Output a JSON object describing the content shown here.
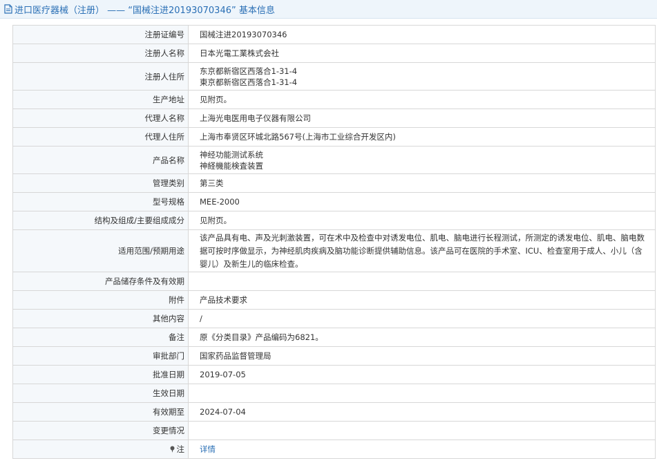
{
  "header": {
    "title": "进口医疗器械（注册） —— “国械注进20193070346” 基本信息",
    "icon": "document-icon"
  },
  "rows": {
    "reg_no": {
      "label": "注册证编号",
      "value": "国械注进20193070346"
    },
    "registrant_name": {
      "label": "注册人名称",
      "value": "日本光電工業株式会社"
    },
    "registrant_address": {
      "label": "注册人住所",
      "value_line1": "东京都新宿区西落合1-31-4",
      "value_line2": "東京都新宿区西落合1-31-4"
    },
    "production_address": {
      "label": "生产地址",
      "value": "见附页。"
    },
    "agent_name": {
      "label": "代理人名称",
      "value": "上海光电医用电子仪器有限公司"
    },
    "agent_address": {
      "label": "代理人住所",
      "value": "上海市奉贤区环城北路567号(上海市工业综合开发区内)"
    },
    "product_name": {
      "label": "产品名称",
      "value_line1": "神经功能测试系统",
      "value_line2": "神経機能検査装置"
    },
    "category": {
      "label": "管理类别",
      "value": "第三类"
    },
    "model": {
      "label": "型号规格",
      "value": "MEE-2000"
    },
    "structure": {
      "label": "结构及组成/主要组成成分",
      "value": "见附页。"
    },
    "scope": {
      "label": "适用范围/预期用途",
      "value": "该产品具有电、声及光刺激装置，可在术中及检查中对诱发电位、肌电、脑电进行长程测试，所测定的诱发电位、肌电、脑电数据可按时序做显示，为神经肌肉疾病及脑功能诊断提供辅助信息。该产品可在医院的手术室、ICU、检查室用于成人、小儿（含婴儿）及新生儿的临床检查。"
    },
    "storage": {
      "label": "产品储存条件及有效期",
      "value": ""
    },
    "attachment": {
      "label": "附件",
      "value": "产品技术要求"
    },
    "other": {
      "label": "其他内容",
      "value": "/"
    },
    "remark": {
      "label": "备注",
      "value": "原《分类目录》产品编码为6821。"
    },
    "approval_dept": {
      "label": "审批部门",
      "value": "国家药品监督管理局"
    },
    "approval_date": {
      "label": "批准日期",
      "value": "2019-07-05"
    },
    "effective_date": {
      "label": "生效日期",
      "value": ""
    },
    "valid_until": {
      "label": "有效期至",
      "value": "2024-07-04"
    },
    "changes": {
      "label": "变更情况",
      "value": ""
    },
    "note": {
      "label": "注",
      "icon": "pin-icon",
      "link": "详情"
    }
  }
}
